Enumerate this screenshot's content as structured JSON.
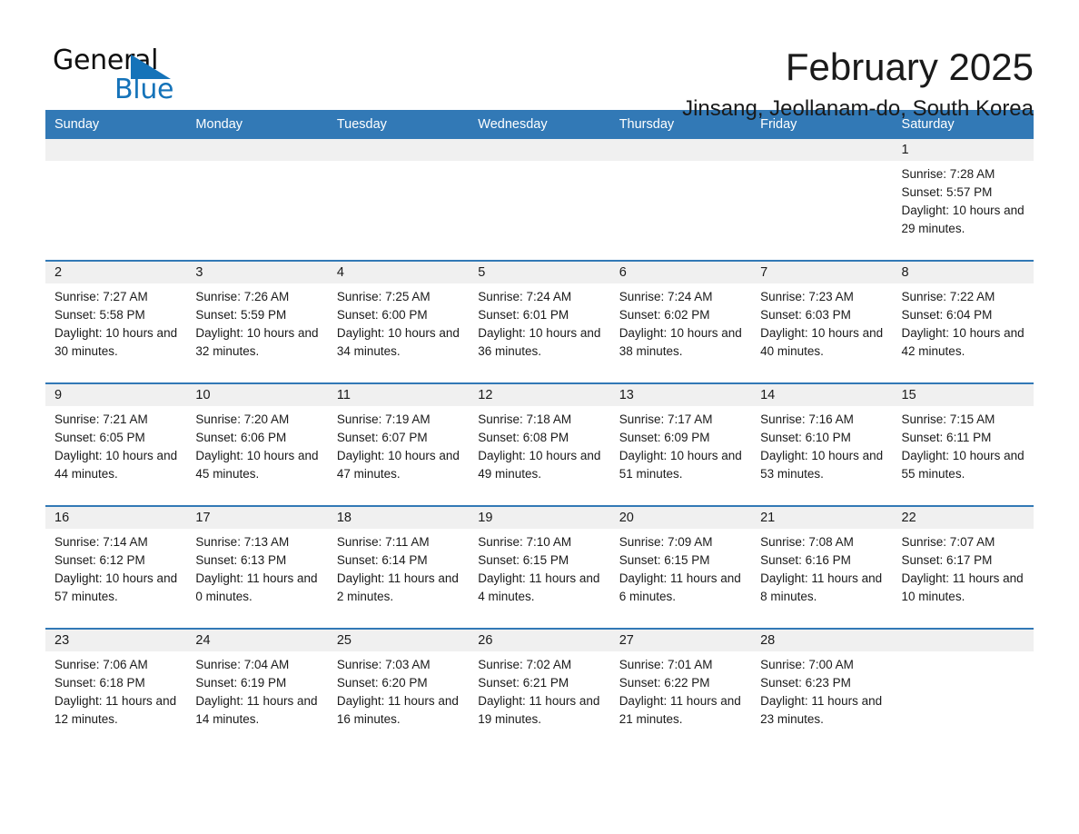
{
  "brand": {
    "name_part1": "General",
    "name_part2": "Blue",
    "accent_color": "#1573b9"
  },
  "header": {
    "month_title": "February 2025",
    "location": "Jinsang, Jeollanam-do, South Korea"
  },
  "calendar": {
    "header_bg": "#3279b6",
    "day_band_bg": "#f0f0f0",
    "weekday_headers": [
      "Sunday",
      "Monday",
      "Tuesday",
      "Wednesday",
      "Thursday",
      "Friday",
      "Saturday"
    ],
    "weeks": [
      {
        "days": [
          {
            "date": "",
            "blank": true
          },
          {
            "date": "",
            "blank": true
          },
          {
            "date": "",
            "blank": true
          },
          {
            "date": "",
            "blank": true
          },
          {
            "date": "",
            "blank": true
          },
          {
            "date": "",
            "blank": true
          },
          {
            "date": "1",
            "sunrise": "Sunrise: 7:28 AM",
            "sunset": "Sunset: 5:57 PM",
            "daylight": "Daylight: 10 hours and 29 minutes."
          }
        ]
      },
      {
        "days": [
          {
            "date": "2",
            "sunrise": "Sunrise: 7:27 AM",
            "sunset": "Sunset: 5:58 PM",
            "daylight": "Daylight: 10 hours and 30 minutes."
          },
          {
            "date": "3",
            "sunrise": "Sunrise: 7:26 AM",
            "sunset": "Sunset: 5:59 PM",
            "daylight": "Daylight: 10 hours and 32 minutes."
          },
          {
            "date": "4",
            "sunrise": "Sunrise: 7:25 AM",
            "sunset": "Sunset: 6:00 PM",
            "daylight": "Daylight: 10 hours and 34 minutes."
          },
          {
            "date": "5",
            "sunrise": "Sunrise: 7:24 AM",
            "sunset": "Sunset: 6:01 PM",
            "daylight": "Daylight: 10 hours and 36 minutes."
          },
          {
            "date": "6",
            "sunrise": "Sunrise: 7:24 AM",
            "sunset": "Sunset: 6:02 PM",
            "daylight": "Daylight: 10 hours and 38 minutes."
          },
          {
            "date": "7",
            "sunrise": "Sunrise: 7:23 AM",
            "sunset": "Sunset: 6:03 PM",
            "daylight": "Daylight: 10 hours and 40 minutes."
          },
          {
            "date": "8",
            "sunrise": "Sunrise: 7:22 AM",
            "sunset": "Sunset: 6:04 PM",
            "daylight": "Daylight: 10 hours and 42 minutes."
          }
        ]
      },
      {
        "days": [
          {
            "date": "9",
            "sunrise": "Sunrise: 7:21 AM",
            "sunset": "Sunset: 6:05 PM",
            "daylight": "Daylight: 10 hours and 44 minutes."
          },
          {
            "date": "10",
            "sunrise": "Sunrise: 7:20 AM",
            "sunset": "Sunset: 6:06 PM",
            "daylight": "Daylight: 10 hours and 45 minutes."
          },
          {
            "date": "11",
            "sunrise": "Sunrise: 7:19 AM",
            "sunset": "Sunset: 6:07 PM",
            "daylight": "Daylight: 10 hours and 47 minutes."
          },
          {
            "date": "12",
            "sunrise": "Sunrise: 7:18 AM",
            "sunset": "Sunset: 6:08 PM",
            "daylight": "Daylight: 10 hours and 49 minutes."
          },
          {
            "date": "13",
            "sunrise": "Sunrise: 7:17 AM",
            "sunset": "Sunset: 6:09 PM",
            "daylight": "Daylight: 10 hours and 51 minutes."
          },
          {
            "date": "14",
            "sunrise": "Sunrise: 7:16 AM",
            "sunset": "Sunset: 6:10 PM",
            "daylight": "Daylight: 10 hours and 53 minutes."
          },
          {
            "date": "15",
            "sunrise": "Sunrise: 7:15 AM",
            "sunset": "Sunset: 6:11 PM",
            "daylight": "Daylight: 10 hours and 55 minutes."
          }
        ]
      },
      {
        "days": [
          {
            "date": "16",
            "sunrise": "Sunrise: 7:14 AM",
            "sunset": "Sunset: 6:12 PM",
            "daylight": "Daylight: 10 hours and 57 minutes."
          },
          {
            "date": "17",
            "sunrise": "Sunrise: 7:13 AM",
            "sunset": "Sunset: 6:13 PM",
            "daylight": "Daylight: 11 hours and 0 minutes."
          },
          {
            "date": "18",
            "sunrise": "Sunrise: 7:11 AM",
            "sunset": "Sunset: 6:14 PM",
            "daylight": "Daylight: 11 hours and 2 minutes."
          },
          {
            "date": "19",
            "sunrise": "Sunrise: 7:10 AM",
            "sunset": "Sunset: 6:15 PM",
            "daylight": "Daylight: 11 hours and 4 minutes."
          },
          {
            "date": "20",
            "sunrise": "Sunrise: 7:09 AM",
            "sunset": "Sunset: 6:15 PM",
            "daylight": "Daylight: 11 hours and 6 minutes."
          },
          {
            "date": "21",
            "sunrise": "Sunrise: 7:08 AM",
            "sunset": "Sunset: 6:16 PM",
            "daylight": "Daylight: 11 hours and 8 minutes."
          },
          {
            "date": "22",
            "sunrise": "Sunrise: 7:07 AM",
            "sunset": "Sunset: 6:17 PM",
            "daylight": "Daylight: 11 hours and 10 minutes."
          }
        ]
      },
      {
        "days": [
          {
            "date": "23",
            "sunrise": "Sunrise: 7:06 AM",
            "sunset": "Sunset: 6:18 PM",
            "daylight": "Daylight: 11 hours and 12 minutes."
          },
          {
            "date": "24",
            "sunrise": "Sunrise: 7:04 AM",
            "sunset": "Sunset: 6:19 PM",
            "daylight": "Daylight: 11 hours and 14 minutes."
          },
          {
            "date": "25",
            "sunrise": "Sunrise: 7:03 AM",
            "sunset": "Sunset: 6:20 PM",
            "daylight": "Daylight: 11 hours and 16 minutes."
          },
          {
            "date": "26",
            "sunrise": "Sunrise: 7:02 AM",
            "sunset": "Sunset: 6:21 PM",
            "daylight": "Daylight: 11 hours and 19 minutes."
          },
          {
            "date": "27",
            "sunrise": "Sunrise: 7:01 AM",
            "sunset": "Sunset: 6:22 PM",
            "daylight": "Daylight: 11 hours and 21 minutes."
          },
          {
            "date": "28",
            "sunrise": "Sunrise: 7:00 AM",
            "sunset": "Sunset: 6:23 PM",
            "daylight": "Daylight: 11 hours and 23 minutes."
          },
          {
            "date": "",
            "blank": true
          }
        ]
      }
    ]
  }
}
